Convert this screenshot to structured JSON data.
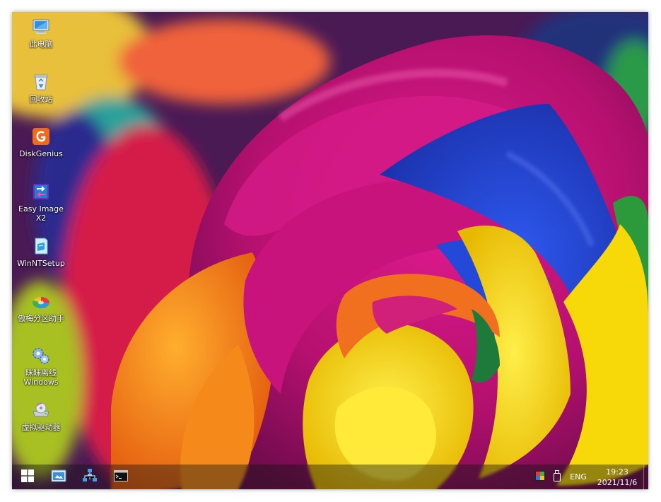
{
  "desktop": {
    "icons": [
      {
        "label": "此电脑",
        "icon": "this-pc-icon"
      },
      {
        "label": "回收站",
        "icon": "recycle-bin-icon"
      },
      {
        "label": "DiskGenius",
        "icon": "diskgenius-icon"
      },
      {
        "label": "Easy Image X2",
        "icon": "easy-image-icon"
      },
      {
        "label": "WinNTSetup",
        "icon": "winntsetup-icon"
      },
      {
        "label": "傲梅分区助手",
        "icon": "aomei-partition-icon"
      },
      {
        "label": "眯眯离线\nWindows",
        "icon": "gears-icon"
      },
      {
        "label": "虚拟驱动器",
        "icon": "virtual-drive-icon"
      }
    ]
  },
  "taskbar": {
    "start_icon": "windows-logo-icon",
    "pinned": [
      {
        "icon": "file-explorer-icon"
      },
      {
        "icon": "network-tool-icon"
      },
      {
        "icon": "command-prompt-icon"
      }
    ],
    "tray": {
      "language": "ENG",
      "time": "19:23",
      "date": "2021/11/6",
      "icons": [
        "color-display-icon",
        "usb-drive-icon"
      ]
    }
  },
  "colors": {
    "accent_magenta": "#c2157a",
    "accent_blue": "#1f3fd6",
    "accent_yellow": "#f5d400",
    "accent_orange": "#f07a12"
  }
}
